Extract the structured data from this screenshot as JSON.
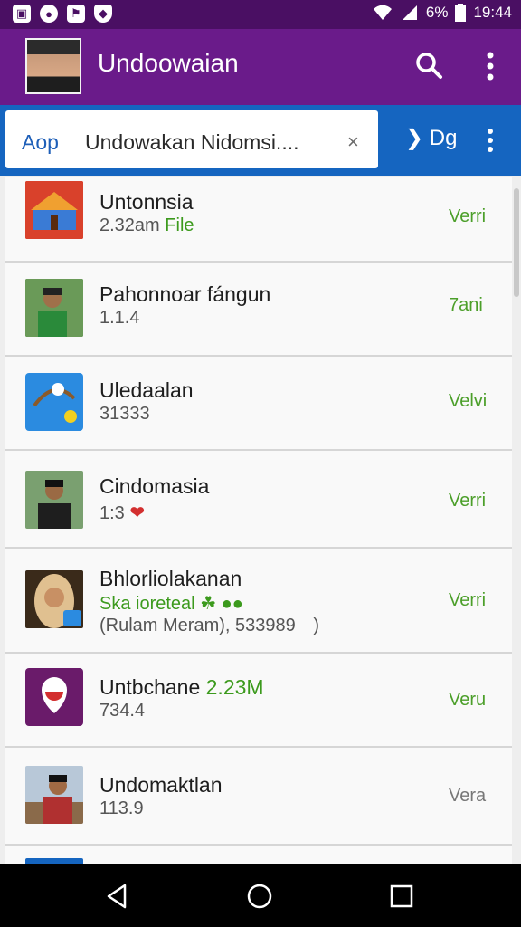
{
  "status_bar": {
    "notification_icons": [
      "image-icon",
      "camera-icon",
      "flag-icon",
      "shield-icon"
    ],
    "battery": "6%",
    "time": "19:44"
  },
  "app_bar": {
    "title": "Undoowaian",
    "icons": [
      "search-icon",
      "more-vert-icon"
    ]
  },
  "search_bar": {
    "prefix": "Aop",
    "value": "Undowakan Nidomsi....",
    "clear": "×",
    "next_tab": "Dg"
  },
  "items": [
    {
      "title": "Untonnsia",
      "sub_prefix": "2.32am",
      "sub_green": "File",
      "action": "Verri",
      "thumb": "temple"
    },
    {
      "title": "Pahonnoar fángun",
      "sub_prefix": "1.1.4",
      "sub_green": "",
      "action": "7ani",
      "thumb": "person-green"
    },
    {
      "title": "Uledaalan",
      "sub_prefix": "31333",
      "sub_green": "",
      "action": "Velvi",
      "thumb": "blue-app"
    },
    {
      "title": "Cindomasia",
      "sub_prefix": "1:3",
      "sub_green": "",
      "action": "Verri",
      "thumb": "person-dark"
    },
    {
      "title": "Bhlorliolakanan",
      "sub_prefix": "",
      "sub_green": "Ska ioreteal",
      "extra_line": "(Rulam Meram), 533989",
      "extra_close": ")",
      "action": "Verri",
      "thumb": "person-hijab"
    },
    {
      "title": "Untbchane",
      "title_green": "2.23M",
      "sub_prefix": "734.4",
      "sub_green": "",
      "action": "Veru",
      "thumb": "purple-app"
    },
    {
      "title": "Undomaktlan",
      "sub_prefix": "113.9",
      "sub_green": "",
      "action": "Vera",
      "thumb": "person-outdoor"
    }
  ],
  "nav_bar": {
    "buttons": [
      "back-icon",
      "home-icon",
      "recents-icon"
    ]
  },
  "colors": {
    "status_bar": "#4a0f63",
    "app_bar": "#6a1b8a",
    "tab_bar": "#1565c0",
    "action_green": "#4c9f2a"
  }
}
